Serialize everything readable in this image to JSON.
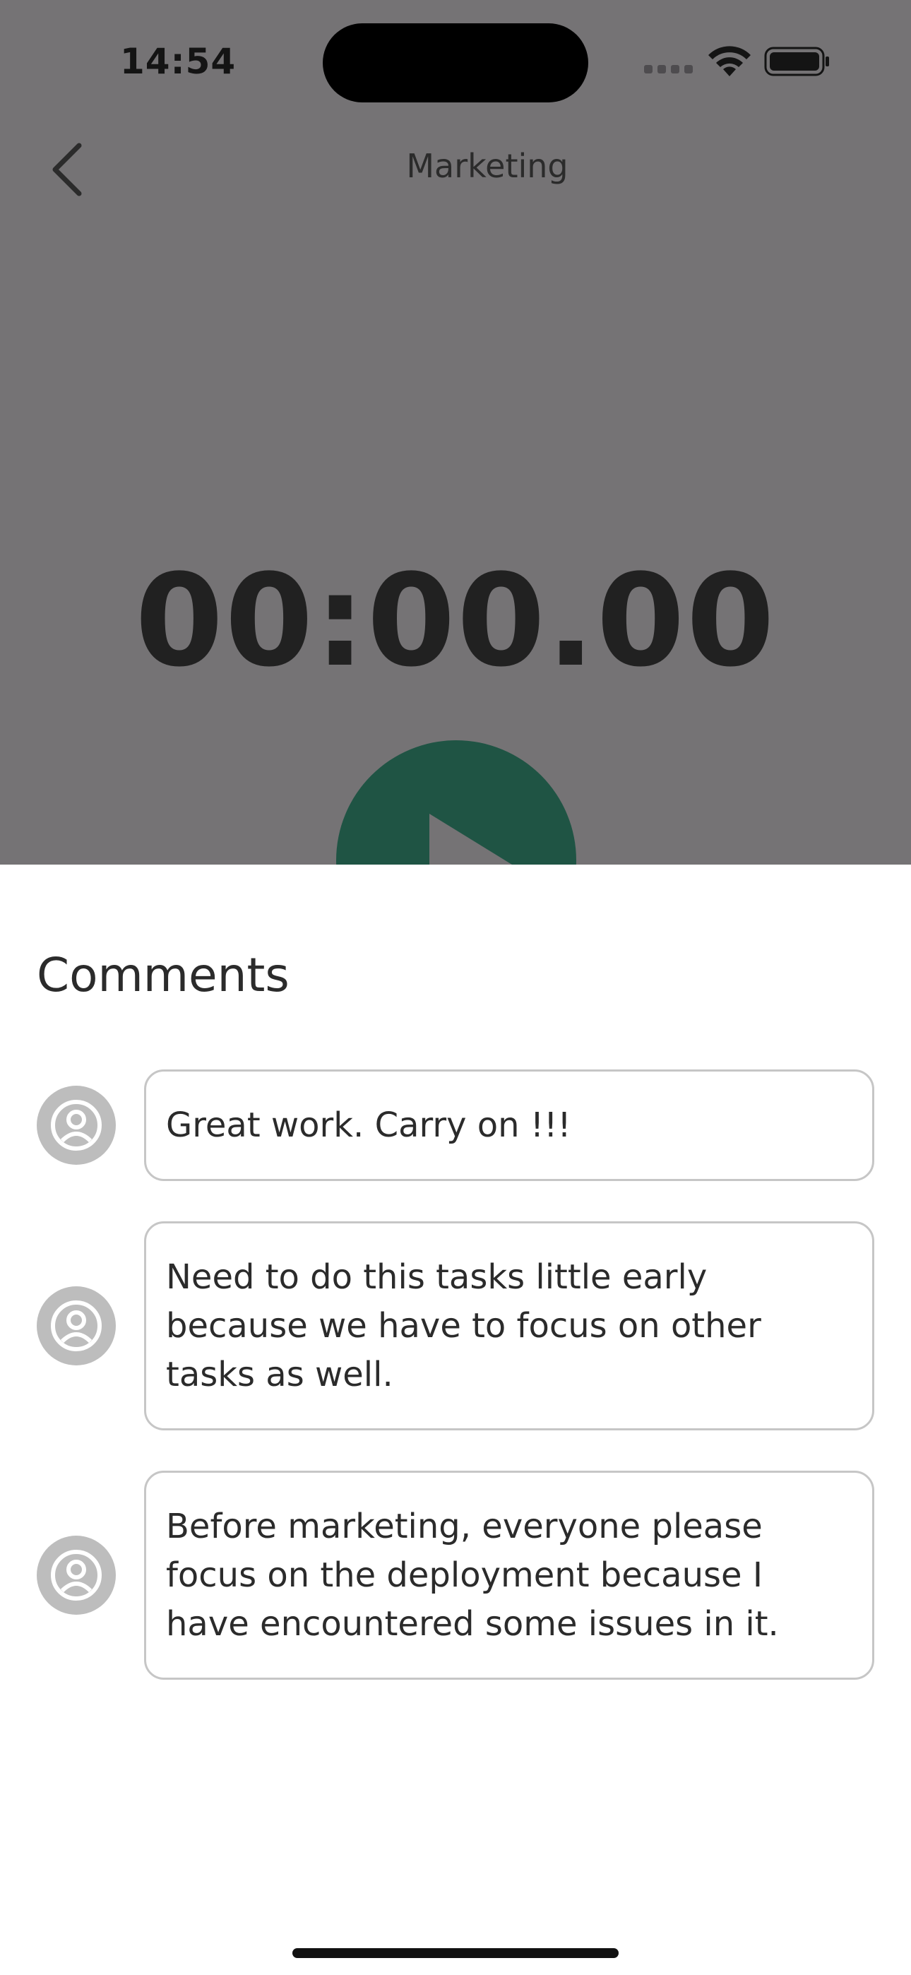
{
  "status_bar": {
    "time": "14:54"
  },
  "nav": {
    "title": "Marketing"
  },
  "timer": {
    "value": "00:00.00"
  },
  "colors": {
    "overlay": "#757375",
    "accent": "#1f5444",
    "avatar": "#bdbdbd"
  },
  "comments_sheet": {
    "title": "Comments",
    "comments": [
      {
        "text": "Great work. Carry on !!!"
      },
      {
        "text": "Need to do this tasks little early because we have to focus on other tasks as well."
      },
      {
        "text": "Before marketing, everyone please focus on the deployment because I have encountered some issues in it."
      }
    ]
  }
}
